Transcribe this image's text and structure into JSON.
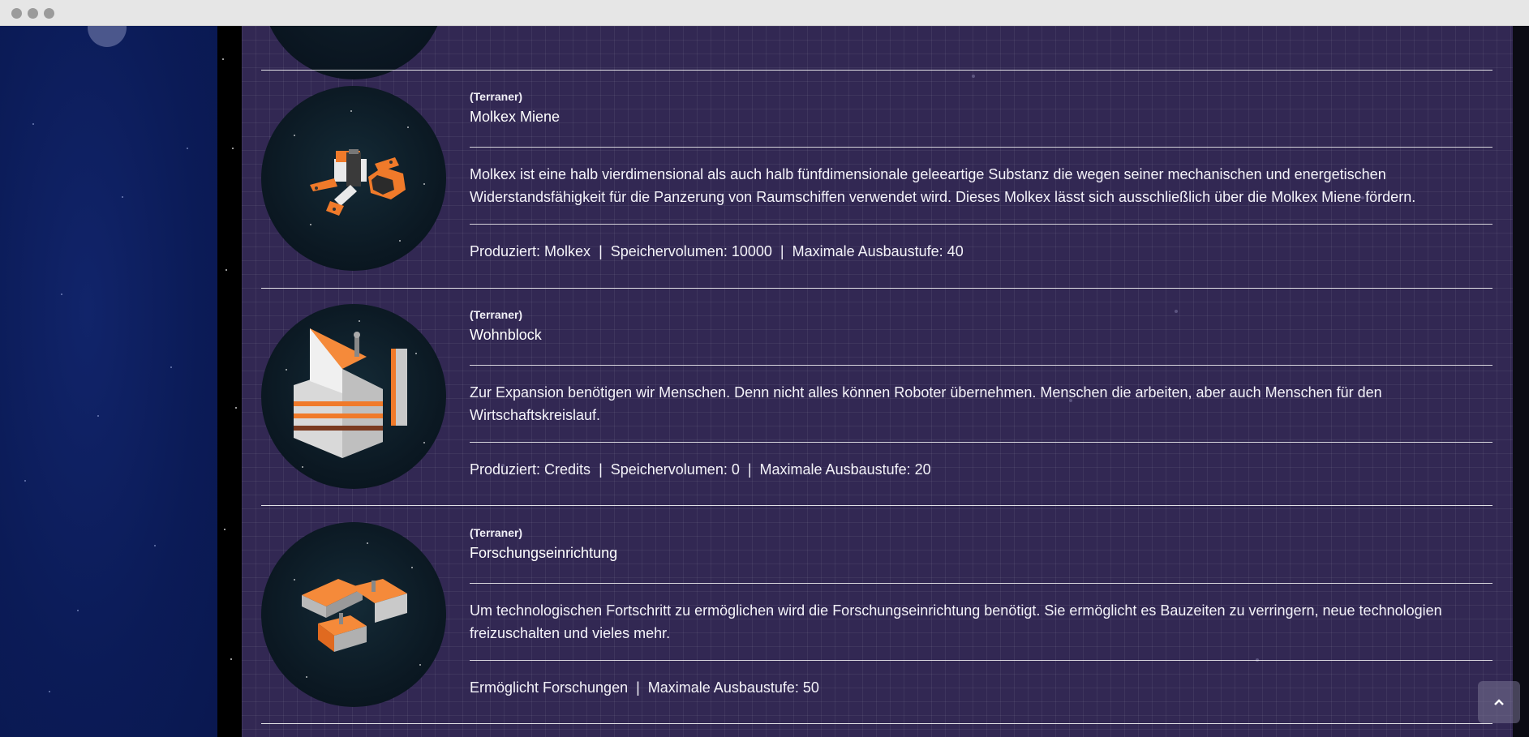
{
  "buildings": [
    {
      "race": "(Terraner)",
      "name": "Molkex Miene",
      "description": "Molkex ist eine halb vierdimensional als auch halb fünfdimensionale geleeartige Substanz die wegen seiner mechanischen und energetischen Widerstandsfähigkeit für die Panzerung von Raumschiffen verwendet wird. Dieses Molkex lässt sich ausschließlich über die Molkex Miene fördern.",
      "stats": [
        "Produziert: Molkex",
        "Speichervolumen: 10000",
        "Maximale Ausbaustufe: 40"
      ],
      "image_icon": "molkex-mine-icon"
    },
    {
      "race": "(Terraner)",
      "name": "Wohnblock",
      "description": "Zur Expansion benötigen wir Menschen. Denn nicht alles können Roboter übernehmen. Menschen die arbeiten, aber auch Menschen für den Wirtschaftskreislauf.",
      "stats": [
        "Produziert: Credits",
        "Speichervolumen: 0",
        "Maximale Ausbaustufe: 20"
      ],
      "image_icon": "residential-block-icon"
    },
    {
      "race": "(Terraner)",
      "name": "Forschungseinrichtung",
      "description": "Um technologischen Fortschritt zu ermöglichen wird die Forschungseinrichtung benötigt. Sie ermöglicht es Bauzeiten zu verringern, neue technologien freizuschalten und vieles mehr.",
      "stats": [
        "Ermöglicht Forschungen",
        "Maximale Ausbaustufe: 50"
      ],
      "image_icon": "research-facility-icon"
    }
  ],
  "stat_separator": "|",
  "scroll_top_icon": "chevron-up-icon",
  "colors": {
    "sidebar": "#0b1b57",
    "panel": "#322853",
    "accent_orange": "#f07a2a"
  }
}
